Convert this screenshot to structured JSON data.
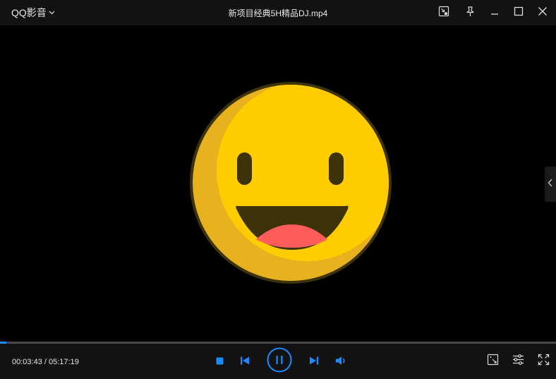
{
  "app": {
    "menu_label": "QQ影音",
    "window_title": "新项目经典5H精品DJ.mp4"
  },
  "playback": {
    "current_time": "00:03:43",
    "separator": " / ",
    "total_time": "05:17:19",
    "progress_fraction": 0.0117,
    "state": "playing"
  },
  "colors": {
    "accent": "#1a8cff",
    "titlebar_bg": "#121212",
    "emoji_yellow": "#ffcc00",
    "emoji_shade": "#e8b21f",
    "emoji_outline": "#3d3208",
    "emoji_tongue": "#ff5c5c"
  },
  "icons": {
    "menu_caret": "chevron-down-icon",
    "mini_mode": "mini-mode-icon",
    "pin": "pin-icon",
    "minimize": "minimize-icon",
    "maximize": "maximize-icon",
    "close": "close-icon",
    "side_panel": "chevron-left-icon",
    "stop": "stop-icon",
    "previous": "skip-previous-icon",
    "pause": "pause-icon",
    "next": "skip-next-icon",
    "volume": "volume-icon",
    "screenshot": "screenshot-icon",
    "settings": "equalizer-settings-icon",
    "fullscreen": "fullscreen-icon"
  }
}
